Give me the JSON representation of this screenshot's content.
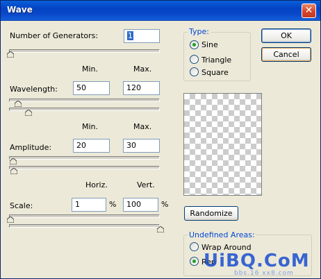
{
  "window": {
    "title": "Wave",
    "close_glyph": "✕"
  },
  "generators": {
    "label": "Number of Generators:",
    "value": "1"
  },
  "header_minmax": {
    "min": "Min.",
    "max": "Max."
  },
  "wavelength": {
    "label": "Wavelength:",
    "min": "50",
    "max": "120"
  },
  "amplitude": {
    "label": "Amplitude:",
    "min": "20",
    "max": "30"
  },
  "header_scale": {
    "horiz": "Horiz.",
    "vert": "Vert."
  },
  "scale": {
    "label": "Scale:",
    "horiz": "1",
    "vert": "100",
    "percent": "%"
  },
  "type_group": {
    "title": "Type:",
    "options": [
      {
        "label": "Sine",
        "checked": true
      },
      {
        "label": "Triangle",
        "checked": false
      },
      {
        "label": "Square",
        "checked": false
      }
    ]
  },
  "buttons": {
    "ok": "OK",
    "cancel": "Cancel",
    "randomize": "Randomize"
  },
  "undefined_group": {
    "title": "Undefined Areas:",
    "options": [
      {
        "label": "Wrap Around",
        "checked": false
      },
      {
        "label": "Rep",
        "checked": true
      }
    ]
  },
  "watermark": {
    "text": "UiBQ.CoM",
    "sub": "bbs.16 xx8.com"
  },
  "colors": {
    "titlebar": "#0a52d4",
    "dialog_bg": "#ece9d8",
    "group_title": "#0046d5"
  }
}
